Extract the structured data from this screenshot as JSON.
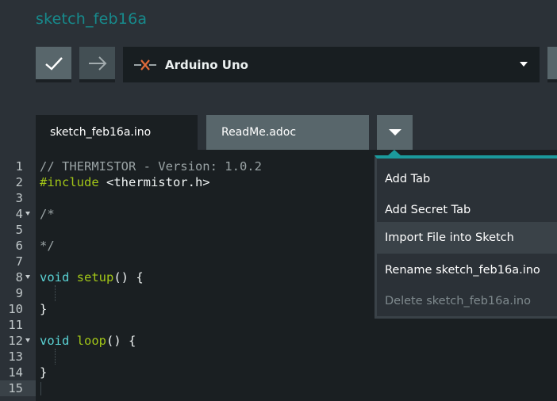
{
  "app": {
    "sketch_title": "sketch_feb16a",
    "colors": {
      "accent": "#178a8c",
      "menu_border": "#1b9a9c",
      "background": "#2b3137",
      "editor_bg": "#1a1f22"
    }
  },
  "toolbar": {
    "verify_icon": "checkmark-icon",
    "upload_icon": "arrow-right-icon",
    "board": {
      "icon": "disconnected-plug-icon",
      "name": "Arduino Uno",
      "dropdown_icon": "caret-down-icon"
    }
  },
  "tabs": [
    {
      "label": "sketch_feb16a.ino",
      "active": true
    },
    {
      "label": "ReadMe.adoc",
      "active": false
    }
  ],
  "tab_menu": {
    "button_icon": "caret-down-icon",
    "items": [
      {
        "label": "Add Tab",
        "enabled": true
      },
      {
        "label": "Add Secret Tab",
        "enabled": true
      },
      {
        "label": "Import File into Sketch",
        "enabled": true,
        "hovered": true
      },
      {
        "label": "Rename sketch_feb16a.ino",
        "enabled": true
      },
      {
        "label": "Delete sketch_feb16a.ino",
        "enabled": false
      }
    ]
  },
  "editor": {
    "current_line": 15,
    "lines": [
      {
        "n": "1",
        "fold": false,
        "tokens": [
          {
            "t": "// THERMISTOR - Version: 1.0.2",
            "c": "comment"
          }
        ]
      },
      {
        "n": "2",
        "fold": false,
        "tokens": [
          {
            "t": "#include",
            "c": "include"
          },
          {
            "t": " <thermistor.h>",
            "c": "plain"
          }
        ]
      },
      {
        "n": "3",
        "fold": false,
        "tokens": []
      },
      {
        "n": "4",
        "fold": true,
        "tokens": [
          {
            "t": "/*",
            "c": "comment"
          }
        ]
      },
      {
        "n": "5",
        "fold": false,
        "tokens": []
      },
      {
        "n": "6",
        "fold": false,
        "tokens": [
          {
            "t": "*/",
            "c": "comment"
          }
        ]
      },
      {
        "n": "7",
        "fold": false,
        "tokens": []
      },
      {
        "n": "8",
        "fold": true,
        "tokens": [
          {
            "t": "void",
            "c": "type"
          },
          {
            "t": " ",
            "c": "plain"
          },
          {
            "t": "setup",
            "c": "func"
          },
          {
            "t": "() {",
            "c": "plain"
          }
        ]
      },
      {
        "n": "9",
        "fold": false,
        "tokens": [],
        "guide": true
      },
      {
        "n": "10",
        "fold": false,
        "tokens": [
          {
            "t": "}",
            "c": "plain"
          }
        ]
      },
      {
        "n": "11",
        "fold": false,
        "tokens": []
      },
      {
        "n": "12",
        "fold": true,
        "tokens": [
          {
            "t": "void",
            "c": "type"
          },
          {
            "t": " ",
            "c": "plain"
          },
          {
            "t": "loop",
            "c": "func"
          },
          {
            "t": "() {",
            "c": "plain"
          }
        ]
      },
      {
        "n": "13",
        "fold": false,
        "tokens": [],
        "guide": true
      },
      {
        "n": "14",
        "fold": false,
        "tokens": [
          {
            "t": "}",
            "c": "plain"
          }
        ]
      },
      {
        "n": "15",
        "fold": false,
        "tokens": []
      }
    ]
  }
}
